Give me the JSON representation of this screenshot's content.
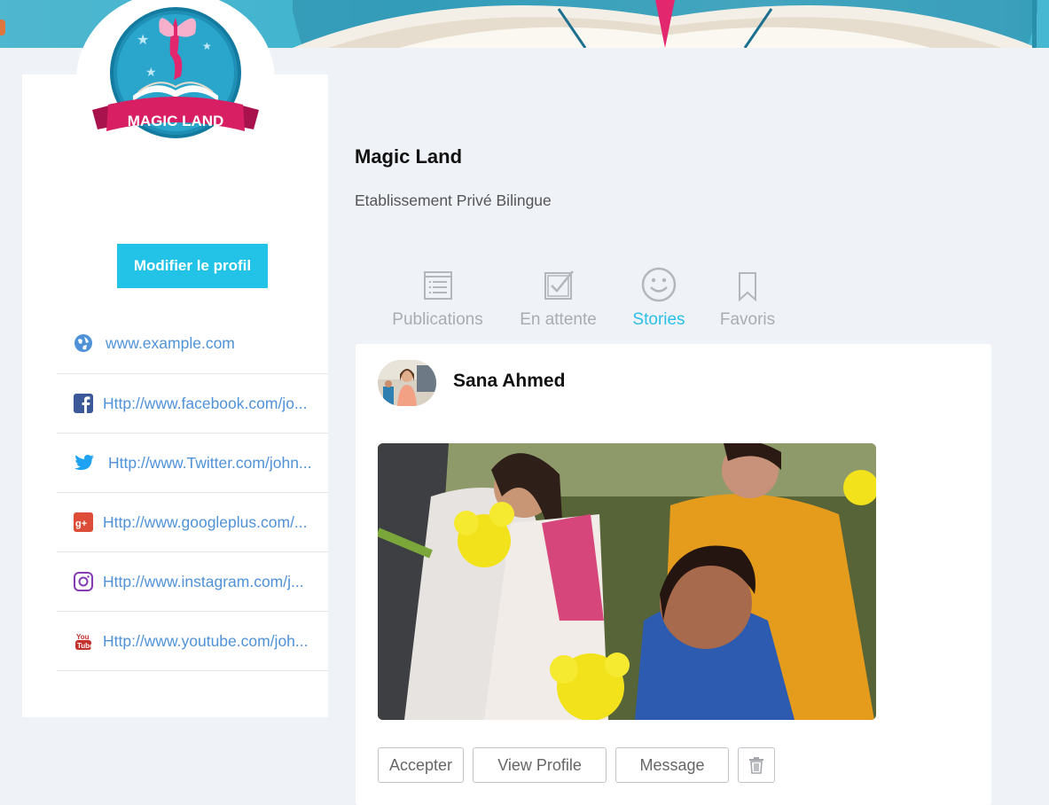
{
  "profile": {
    "name": "Magic Land",
    "tagline": "Etablissement Privé Bilingue",
    "logo_text": "MAGIC LAND",
    "edit_button": "Modifier le profil"
  },
  "links": [
    {
      "icon": "globe-icon",
      "text": "www.example.com",
      "color": "#4f92d8"
    },
    {
      "icon": "facebook-icon",
      "text": "Http://www.facebook.com/jo...",
      "color": "#3b5998"
    },
    {
      "icon": "twitter-icon",
      "text": "Http://www.Twitter.com/john...",
      "color": "#1da1f2"
    },
    {
      "icon": "googleplus-icon",
      "text": "Http://www.googleplus.com/...",
      "color": "#dd4b39"
    },
    {
      "icon": "instagram-icon",
      "text": "Http://www.instagram.com/j...",
      "color": "#833ab4"
    },
    {
      "icon": "youtube-icon",
      "text": "Http://www.youtube.com/joh...",
      "color": "#c4302b"
    }
  ],
  "tabs": [
    {
      "icon": "list-icon",
      "label": "Publications",
      "active": false
    },
    {
      "icon": "checkbox-icon",
      "label": "En attente",
      "active": false
    },
    {
      "icon": "smiley-icon",
      "label": "Stories",
      "active": true
    },
    {
      "icon": "bookmark-icon",
      "label": "Favoris",
      "active": false
    }
  ],
  "post": {
    "author": "Sana Ahmed",
    "actions": {
      "accept": "Accepter",
      "view_profile": "View Profile",
      "message": "Message"
    }
  },
  "colors": {
    "accent": "#23c3e8",
    "link": "#4f92d8",
    "background": "#eff2f7"
  }
}
